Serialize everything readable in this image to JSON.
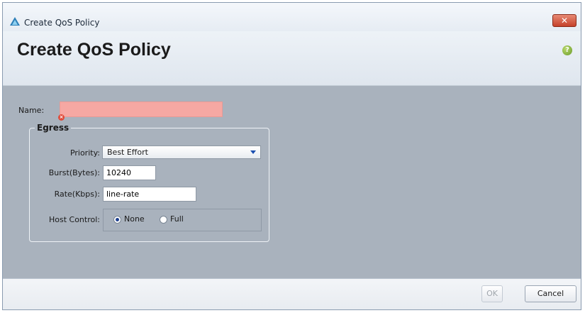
{
  "window": {
    "title": "Create QoS Policy",
    "close_glyph": "✕"
  },
  "header": {
    "title": "Create QoS Policy",
    "help_glyph": "?"
  },
  "form": {
    "name_label": "Name:",
    "name_value": "",
    "error_glyph": "×",
    "egress": {
      "legend": "Egress",
      "priority_label": "Priority:",
      "priority_value": "Best Effort",
      "burst_label": "Burst(Bytes):",
      "burst_value": "10240",
      "rate_label": "Rate(Kbps):",
      "rate_value": "line-rate",
      "host_control_label": "Host Control:",
      "host_control_options": [
        "None",
        "Full"
      ],
      "host_control_selected": "None"
    }
  },
  "footer": {
    "ok_label": "OK",
    "cancel_label": "Cancel"
  },
  "icons": {
    "app": "cisco-triangle-icon",
    "close": "close-icon",
    "help": "help-icon",
    "error": "error-icon",
    "dropdown": "chevron-down-icon"
  },
  "colors": {
    "content_bg": "#a9b2bd",
    "invalid_field": "#f6a8a3",
    "close_button": "#c5412a",
    "help_icon": "#6a9a2a"
  }
}
